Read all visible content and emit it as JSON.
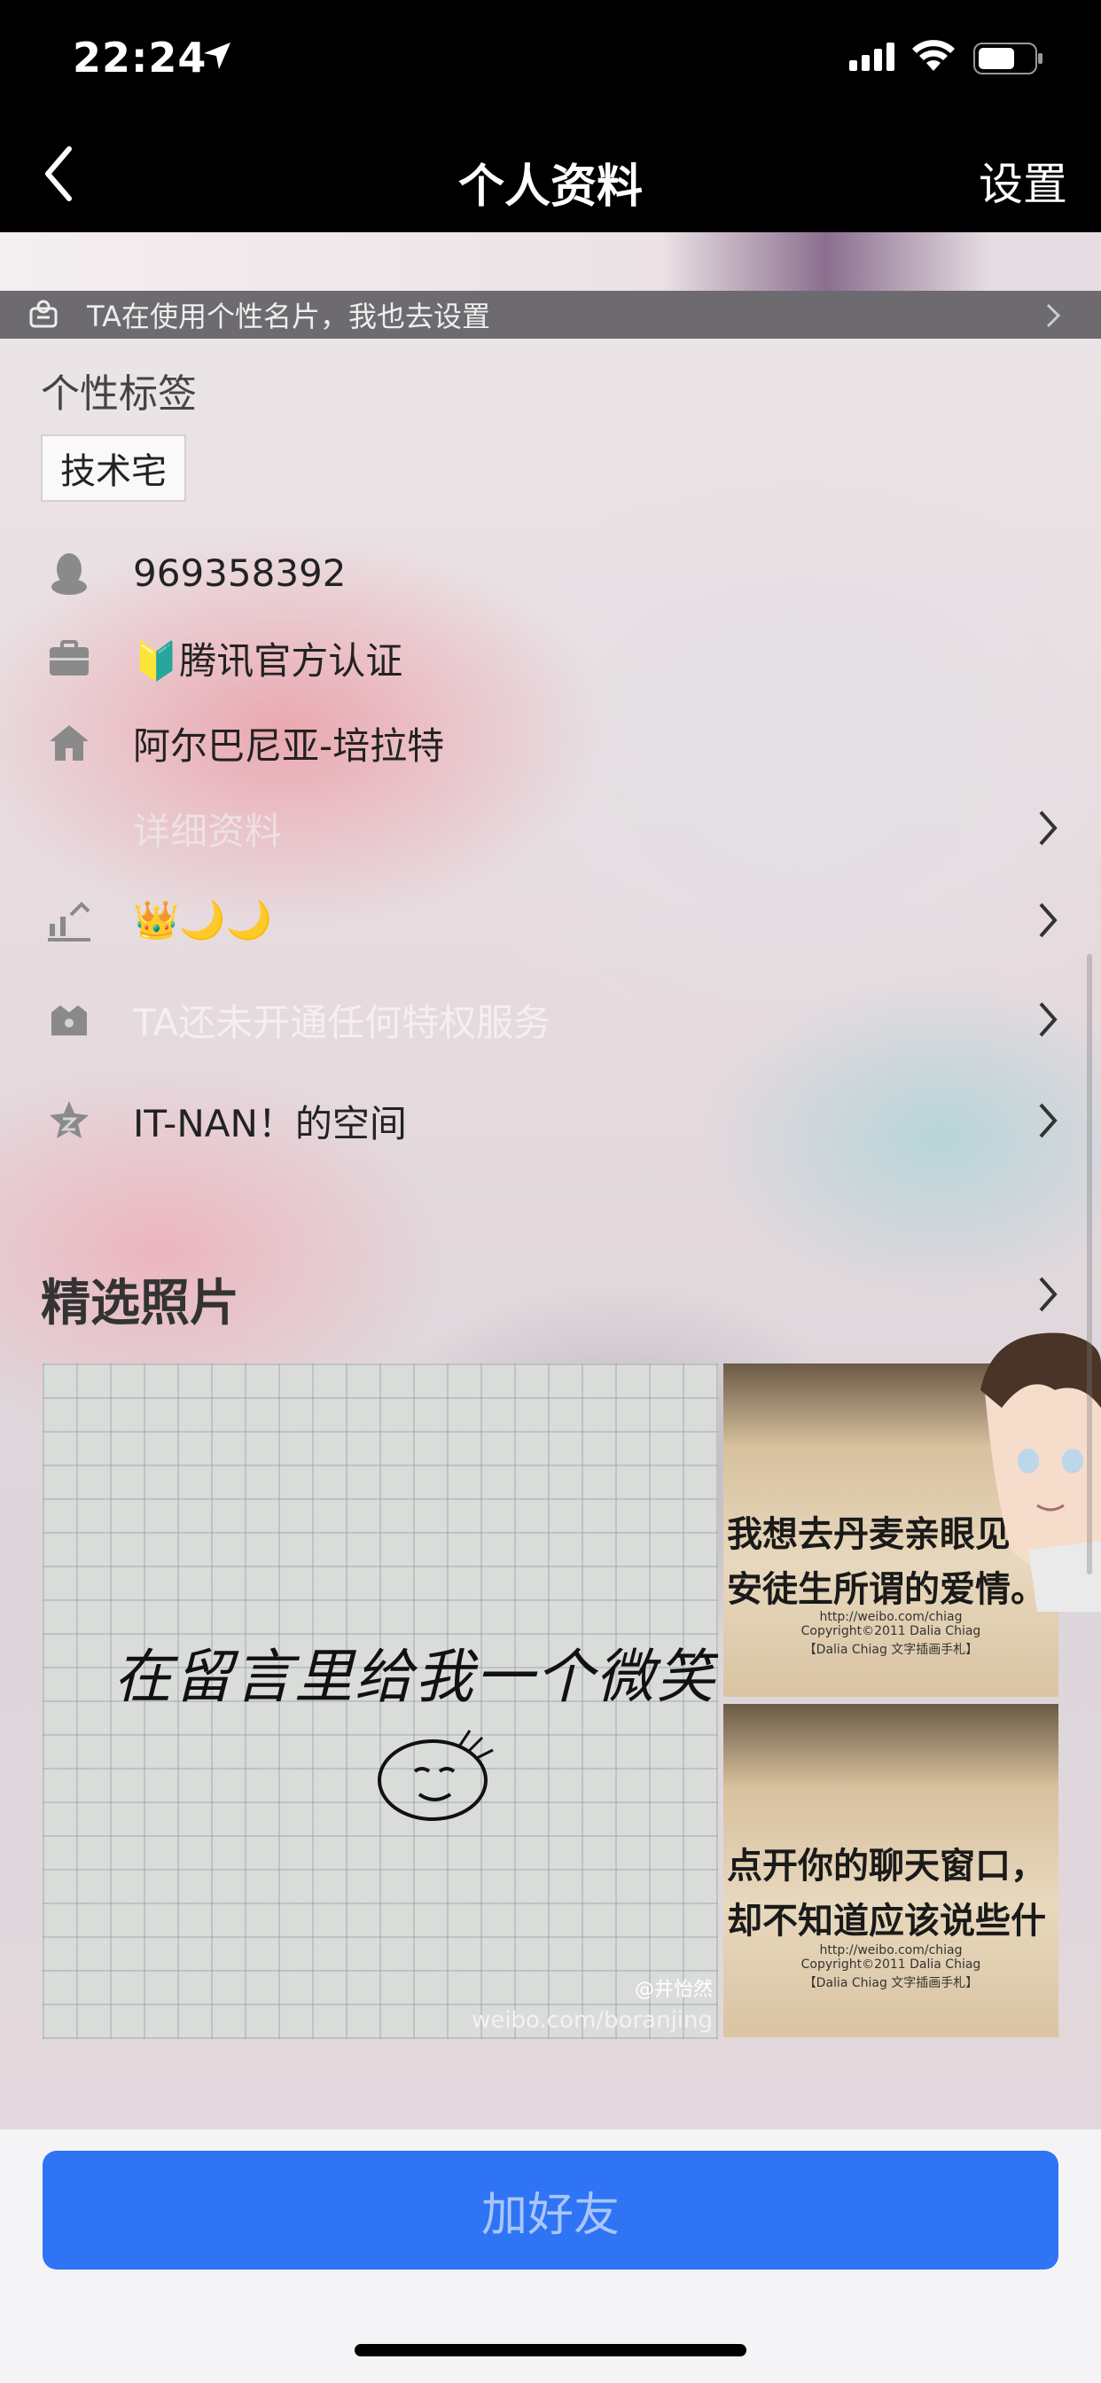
{
  "status_bar": {
    "time": "22:24"
  },
  "nav": {
    "title": "个人资料",
    "settings": "设置"
  },
  "banner": {
    "text": "TA在使用个性名片，我也去设置"
  },
  "tags": {
    "label": "个性标签",
    "items": [
      "技术宅"
    ]
  },
  "rows": {
    "qq": "969358392",
    "cert": "🔰腾讯官方认证",
    "location": "阿尔巴尼亚-培拉特",
    "details": "详细资料",
    "level": "👑🌙🌙",
    "privilege": "TA还未开通任何特权服务",
    "space": "IT-NAN！的空间"
  },
  "photos": {
    "title": "精选照片",
    "main_text": "在留言里给我一个微笑",
    "main_watermark_1": "@井怡然",
    "main_watermark_2": "weibo.com/boranjing",
    "photo2_line1": "我想去丹麦亲眼见识一段",
    "photo2_line2": "安徒生所谓的爱情。",
    "photo3_line1": "点开你的聊天窗口，",
    "photo3_line2": "却不知道应该说些什",
    "caption_url": "http://weibo.com/chiag",
    "caption_copy": "Copyright©2011 Dalia Chiag",
    "caption_sign": "【Dalia Chiag 文字插画手札】"
  },
  "action": {
    "add_friend": "加好友"
  },
  "colors": {
    "accent": "#2f74f5",
    "header_bg": "#000000"
  }
}
